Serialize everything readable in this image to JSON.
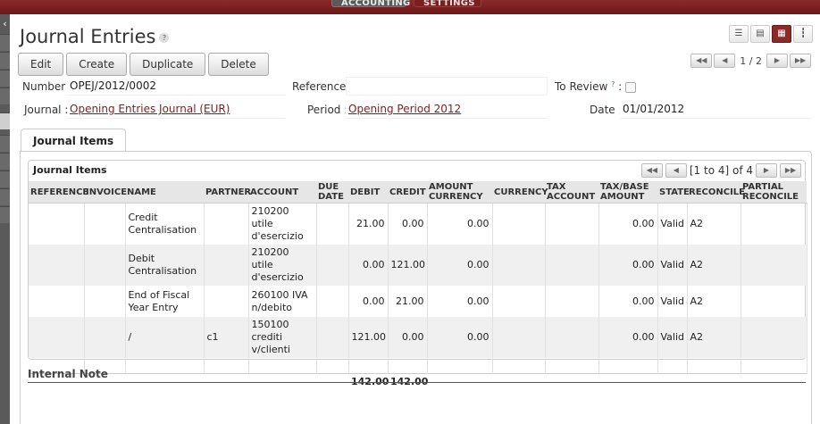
{
  "topnav": {
    "active": "ACCOUNTING",
    "other": "SETTINGS"
  },
  "rail": {
    "toggle_label": "‹"
  },
  "page": {
    "title": "Journal Entries",
    "help": "?"
  },
  "views": [
    "list-icon",
    "form-icon",
    "grid-icon",
    "graph-icon"
  ],
  "buttons": {
    "edit": "Edit",
    "create": "Create",
    "duplicate": "Duplicate",
    "delete": "Delete"
  },
  "pager": {
    "count": "1 / 2"
  },
  "form": {
    "number_label": "Number :",
    "number_value": "OPEJ/2012/0002",
    "reference_label": "Reference :",
    "reference_value": "",
    "to_review_label": "To Review",
    "to_review_help": "?",
    "to_review_colon": ":",
    "journal_label": "Journal :",
    "journal_value": "Opening Entries Journal (EUR)",
    "period_label": "Period :",
    "period_value": "Opening Period 2012",
    "date_label": "Date :",
    "date_value": "01/01/2012"
  },
  "tab": {
    "label": "Journal Items"
  },
  "items": {
    "title": "Journal Items",
    "pager": "[1 to 4] of 4",
    "columns": [
      "REFERENCE",
      "INVOICE",
      "NAME",
      "PARTNER",
      "ACCOUNT",
      "DUE DATE",
      "DEBIT",
      "CREDIT",
      "AMOUNT CURRENCY",
      "CURRENCY",
      "TAX ACCOUNT",
      "TAX/BASE AMOUNT",
      "STATE",
      "RECONCILE",
      "PARTIAL RECONCILE"
    ],
    "rows": [
      {
        "name": "Credit Centralisation",
        "partner": "",
        "account": "210200 utile d'esercizio",
        "debit": "21.00",
        "credit": "0.00",
        "amount_currency": "0.00",
        "tax_base": "0.00",
        "state": "Valid",
        "reconcile": "A2"
      },
      {
        "name": "Debit Centralisation",
        "partner": "",
        "account": "210200 utile d'esercizio",
        "debit": "0.00",
        "credit": "121.00",
        "amount_currency": "0.00",
        "tax_base": "0.00",
        "state": "Valid",
        "reconcile": "A2"
      },
      {
        "name": "End of Fiscal Year Entry",
        "partner": "",
        "account": "260100 IVA n/debito",
        "debit": "0.00",
        "credit": "21.00",
        "amount_currency": "0.00",
        "tax_base": "0.00",
        "state": "Valid",
        "reconcile": "A2"
      },
      {
        "name": "/",
        "partner": "c1",
        "account": "150100 crediti v/clienti",
        "debit": "121.00",
        "credit": "0.00",
        "amount_currency": "0.00",
        "tax_base": "0.00",
        "state": "Valid",
        "reconcile": "A2"
      }
    ],
    "totals": {
      "debit": "142.00",
      "credit": "142.00"
    }
  },
  "note": {
    "title": "Internal Note"
  }
}
